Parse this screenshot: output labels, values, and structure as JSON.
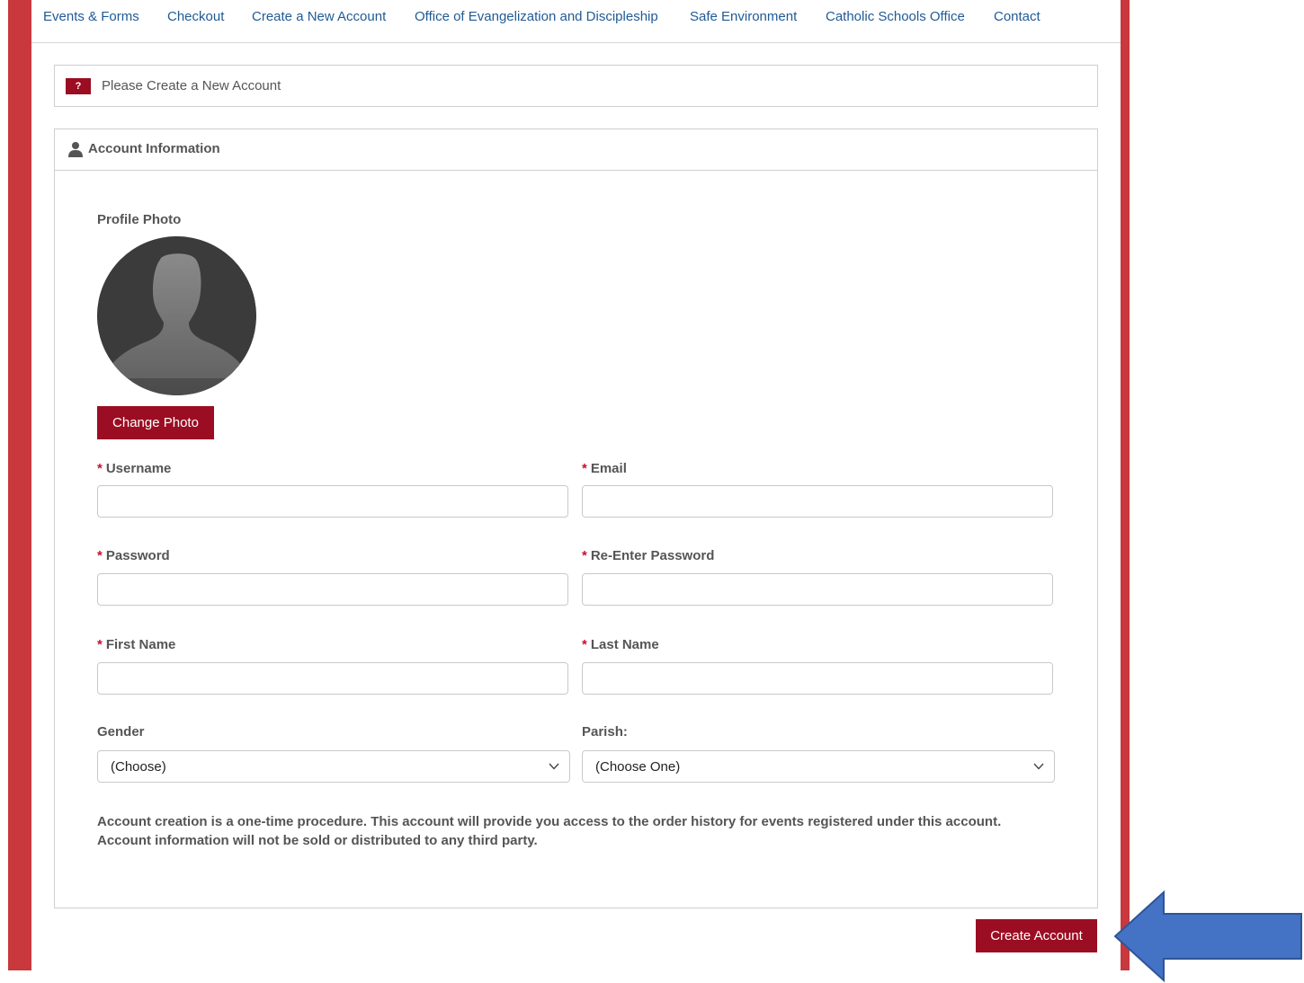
{
  "nav": {
    "items": [
      "Events & Forms",
      "Checkout",
      "Create a New Account",
      "Office of Evangelization and Discipleship",
      "Safe Environment",
      "Catholic Schools Office",
      "Contact"
    ]
  },
  "notice": {
    "badge": "?",
    "text": "Please Create a New Account"
  },
  "panel": {
    "title": "Account Information",
    "profile_photo_label": "Profile Photo",
    "change_photo_button": "Change Photo"
  },
  "form": {
    "required_mark": "*",
    "username_label": "Username",
    "email_label": "Email",
    "password_label": "Password",
    "reenter_password_label": "Re-Enter Password",
    "first_name_label": "First Name",
    "last_name_label": "Last Name",
    "gender_label": "Gender",
    "gender_value": "(Choose)",
    "parish_label": "Parish:",
    "parish_value": "(Choose One)"
  },
  "note": {
    "line1": "Account creation is a one-time procedure. This account will provide you access to the order history for events registered under this account.",
    "line2": "Account information will not be sold or distributed to any third party."
  },
  "actions": {
    "create_account_button": "Create Account"
  },
  "colors": {
    "accent": "#9b0d22",
    "side_bar": "#c8383c",
    "link": "#1f5a96",
    "arrow": "#4472c4"
  }
}
